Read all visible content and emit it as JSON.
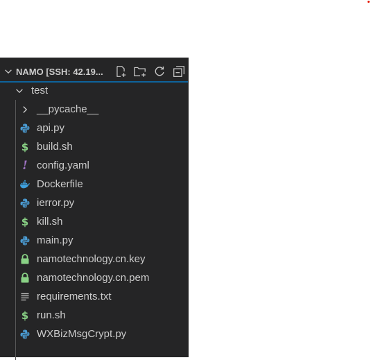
{
  "colors": {
    "panel_bg": "#252526",
    "text": "#cccccc",
    "accent_divider": "#0e639c",
    "python_icon": "#4b9cd3",
    "shell_icon": "#89d185",
    "yaml_icon": "#a074c4",
    "docker_icon": "#3ea0de",
    "lock_icon": "#89d185",
    "text_icon": "#cccccc",
    "red_dot": "#e51400"
  },
  "explorer": {
    "title": "NAMO [SSH: 42.19...",
    "actions": [
      {
        "name": "new-file-icon"
      },
      {
        "name": "new-folder-icon"
      },
      {
        "name": "refresh-icon"
      },
      {
        "name": "collapse-all-icon"
      }
    ],
    "folder": {
      "label": "test",
      "expanded": true
    },
    "items": [
      {
        "label": "__pycache__",
        "icon": "chevron-right-icon",
        "kind": "folder"
      },
      {
        "label": "api.py",
        "icon": "python-icon",
        "kind": "python"
      },
      {
        "label": "build.sh",
        "icon": "dollar-icon",
        "kind": "shell"
      },
      {
        "label": "config.yaml",
        "icon": "exclamation-icon",
        "kind": "yaml"
      },
      {
        "label": "Dockerfile",
        "icon": "docker-icon",
        "kind": "docker"
      },
      {
        "label": "ierror.py",
        "icon": "python-icon",
        "kind": "python"
      },
      {
        "label": "kill.sh",
        "icon": "dollar-icon",
        "kind": "shell"
      },
      {
        "label": "main.py",
        "icon": "python-icon",
        "kind": "python"
      },
      {
        "label": "namotechnology.cn.key",
        "icon": "lock-icon",
        "kind": "lock"
      },
      {
        "label": "namotechnology.cn.pem",
        "icon": "lock-icon",
        "kind": "lock"
      },
      {
        "label": "requirements.txt",
        "icon": "lines-icon",
        "kind": "text"
      },
      {
        "label": "run.sh",
        "icon": "dollar-icon",
        "kind": "shell"
      },
      {
        "label": "WXBizMsgCrypt.py",
        "icon": "python-icon",
        "kind": "python"
      }
    ]
  }
}
